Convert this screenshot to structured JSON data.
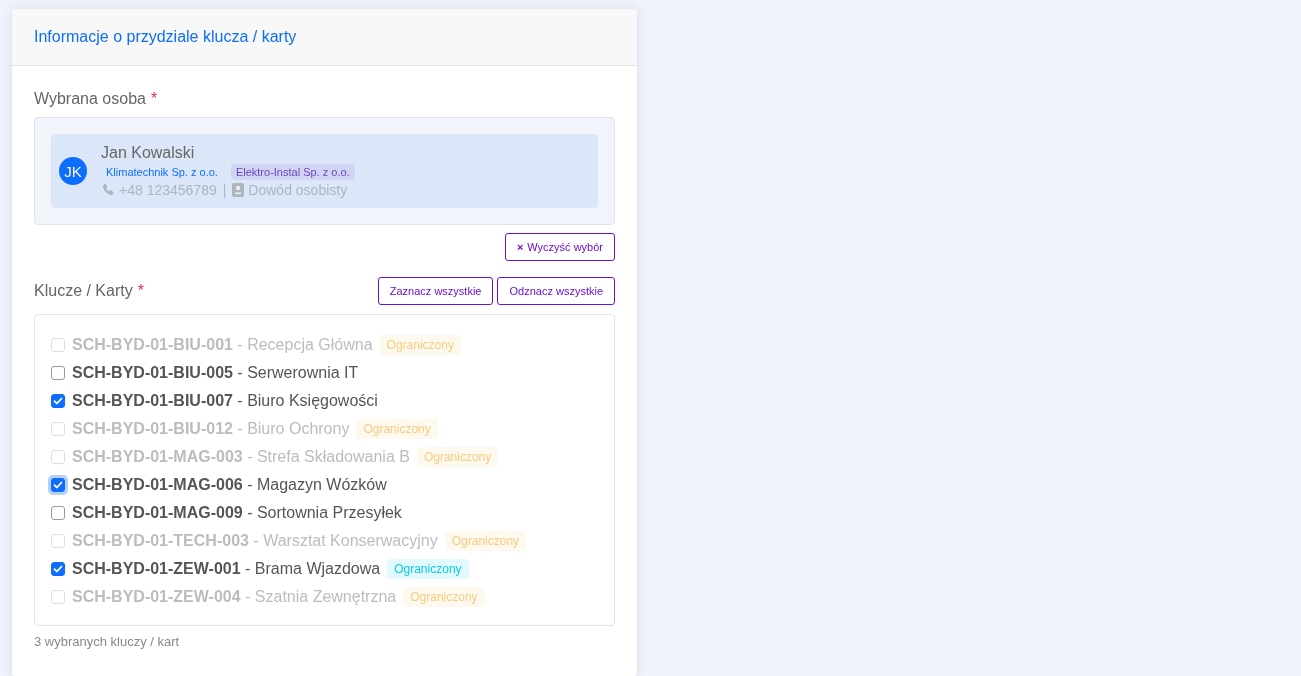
{
  "card": {
    "title": "Informacje o przydziale klucza / karty"
  },
  "person_section": {
    "label": "Wybrana osoba",
    "required_mark": "*",
    "person": {
      "initials": "JK",
      "name": "Jan Kowalski",
      "companies": [
        {
          "label": "Klimatechnik Sp. z o.o.",
          "color": "#0d6efd"
        },
        {
          "label": "Elektro-Instal Sp. z o.o.",
          "color": "#6f42c1"
        }
      ],
      "phone": "+48 123456789",
      "separator": "|",
      "document": "Dowód osobisty"
    },
    "clear_button": {
      "icon": "×",
      "label": "Wyczyść wybór"
    }
  },
  "keys_section": {
    "label": "Klucze / Karty",
    "required_mark": "*",
    "buttons": [
      "Zaznacz wszystkie",
      "Odznacz wszystkie"
    ],
    "items": [
      {
        "code": "SCH-BYD-01-BIU-001",
        "name": "- Recepcja Główna",
        "checked": false,
        "disabled": true,
        "focused": false,
        "badge": {
          "label": "Ograniczony",
          "color": "#f7cd7c"
        }
      },
      {
        "code": "SCH-BYD-01-BIU-005",
        "name": "- Serwerownia IT",
        "checked": false,
        "disabled": false,
        "focused": false
      },
      {
        "code": "SCH-BYD-01-BIU-007",
        "name": "- Biuro Księgowości",
        "checked": true,
        "disabled": false,
        "focused": false
      },
      {
        "code": "SCH-BYD-01-BIU-012",
        "name": "- Biuro Ochrony",
        "checked": false,
        "disabled": true,
        "focused": false,
        "badge": {
          "label": "Ograniczony",
          "color": "#f7cd7c"
        }
      },
      {
        "code": "SCH-BYD-01-MAG-003",
        "name": "- Strefa Składowania B",
        "checked": false,
        "disabled": true,
        "focused": false,
        "badge": {
          "label": "Ograniczony",
          "color": "#f7cd7c"
        }
      },
      {
        "code": "SCH-BYD-01-MAG-006",
        "name": "- Magazyn Wózków",
        "checked": true,
        "disabled": false,
        "focused": true
      },
      {
        "code": "SCH-BYD-01-MAG-009",
        "name": "- Sortownia Przesyłek",
        "checked": false,
        "disabled": false,
        "focused": false
      },
      {
        "code": "SCH-BYD-01-TECH-003",
        "name": "- Warsztat Konserwacyjny",
        "checked": false,
        "disabled": true,
        "focused": false,
        "badge": {
          "label": "Ograniczony",
          "color": "#f7cd7c"
        }
      },
      {
        "code": "SCH-BYD-01-ZEW-001",
        "name": "- Brama Wjazdowa",
        "checked": true,
        "disabled": false,
        "focused": false,
        "badge": {
          "label": "Ograniczony",
          "color": "#0dcaf0"
        }
      },
      {
        "code": "SCH-BYD-01-ZEW-004",
        "name": "- Szatnia Zewnętrzna",
        "checked": false,
        "disabled": true,
        "focused": false,
        "badge": {
          "label": "Ograniczony",
          "color": "#f7cd7c"
        }
      }
    ],
    "summary": "3 wybranych kluczy / kart"
  }
}
